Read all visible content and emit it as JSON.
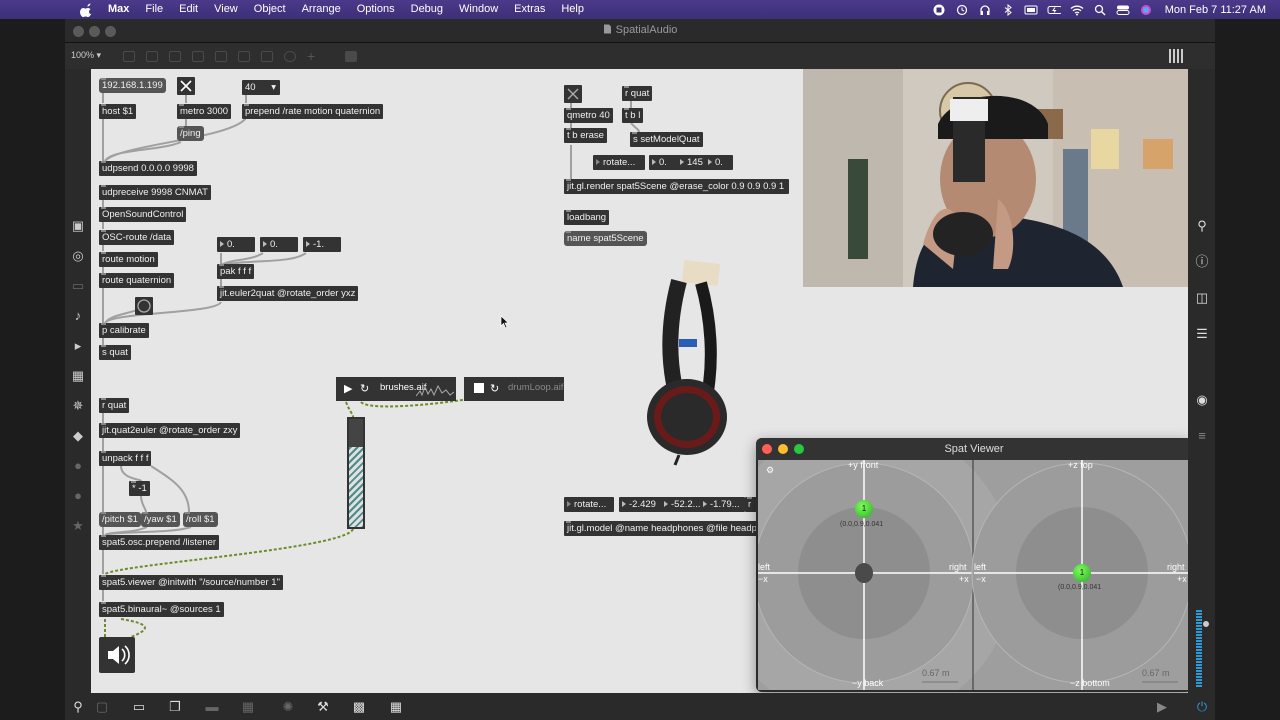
{
  "menubar": {
    "app": "Max",
    "items": [
      "File",
      "Edit",
      "View",
      "Object",
      "Arrange",
      "Options",
      "Debug",
      "Window",
      "Extras",
      "Help"
    ],
    "clock": "Mon Feb 7  11:27 AM",
    "status_icons": [
      "record-icon",
      "time-machine-icon",
      "headphones-icon",
      "bluetooth-icon",
      "display-icon",
      "battery-icon",
      "wifi-icon",
      "search-icon",
      "control-center-icon",
      "siri-icon"
    ]
  },
  "window": {
    "title": "SpatialAudio",
    "zoom": "100%"
  },
  "patch": {
    "ip_msg": "192.168.1.199",
    "host": "host $1",
    "metro": "metro 3000",
    "ping": "/ping",
    "rate_num": "40",
    "prepend_rate": "prepend /rate motion quaternion",
    "udpsend": "udpsend 0.0.0.0 9998",
    "udpreceive": "udpreceive 9998 CNMAT",
    "osc": "OpenSoundControl",
    "osc_route": "OSC-route /data",
    "route_motion": "route motion",
    "route_quaternion": "route quaternion",
    "num_a": "0.",
    "num_b": "0.",
    "num_c": "-1.",
    "pak": "pak f f f",
    "euler2quat": "jit.euler2quat @rotate_order yxz",
    "p_calibrate": "p calibrate",
    "s_quat": "s quat",
    "r_quat_left": "r quat",
    "quat2euler": "jit.quat2euler @rotate_order zxy",
    "unpack": "unpack f f f",
    "mul": "* -1",
    "pitch": "/pitch $1",
    "yaw": "/yaw $1",
    "roll": "/roll $1",
    "prepend_listener": "spat5.osc.prepend /listener",
    "viewer": "spat5.viewer @initwith \"/source/number 1\"",
    "binaural": "spat5.binaural~ @sources 1",
    "r_quat_top": "r quat",
    "qmetro": "qmetro 40",
    "tbl": "t b l",
    "tb_erase": "t b erase",
    "set_model_quat": "s setModelQuat",
    "rotate_top": "rotate...",
    "rot_n1": "0.",
    "rot_n2": "145",
    "rot_n3": "0.",
    "render": "jit.gl.render spat5Scene @erase_color 0.9 0.9 0.9 1",
    "loadbang": "loadbang",
    "name_scene": "name spat5Scene",
    "player1": "brushes.aif",
    "player2": "drumLoop.aif",
    "rotate_model": "rotate...",
    "model_n1": "-2.429",
    "model_n2": "-52.2...",
    "model_n3": "-1.79...",
    "model_n4": "r",
    "gl_model": "jit.gl.model @name headphones @file headp"
  },
  "spat_viewer": {
    "title": "Spat Viewer",
    "top_view": {
      "front": "+y front",
      "back": "−y back",
      "left": "left",
      "left_axis": "−x",
      "right": "right",
      "right_axis": "+x"
    },
    "side_view": {
      "top": "+z top",
      "bottom": "−z bottom",
      "left": "left",
      "left_axis": "−x",
      "right": "right",
      "right_axis": "+x"
    },
    "source_label": "1",
    "source_coords": "(0.0,0.9,0.041",
    "scale": "0.67 m"
  },
  "colors": {
    "canvas": "#e6e6e6",
    "object": "#333333",
    "menubar": "#3d2f78",
    "source_green": "#33cc33"
  }
}
